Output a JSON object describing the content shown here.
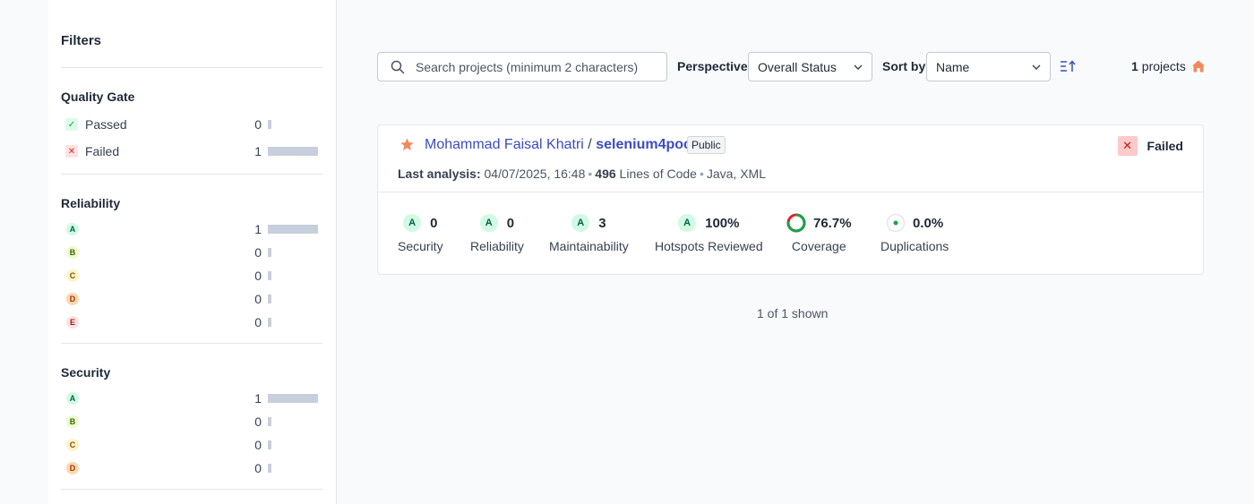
{
  "sidebar": {
    "title": "Filters",
    "quality_gate": {
      "title": "Quality Gate",
      "items": [
        {
          "label": "Passed",
          "count": "0",
          "fraction": 0
        },
        {
          "label": "Failed",
          "count": "1",
          "fraction": 1
        }
      ]
    },
    "reliability": {
      "title": "Reliability",
      "items": [
        {
          "rating": "A",
          "count": "1",
          "fraction": 1
        },
        {
          "rating": "B",
          "count": "0",
          "fraction": 0
        },
        {
          "rating": "C",
          "count": "0",
          "fraction": 0
        },
        {
          "rating": "D",
          "count": "0",
          "fraction": 0
        },
        {
          "rating": "E",
          "count": "0",
          "fraction": 0
        }
      ]
    },
    "security": {
      "title": "Security",
      "items": [
        {
          "rating": "A",
          "count": "1",
          "fraction": 1
        },
        {
          "rating": "B",
          "count": "0",
          "fraction": 0
        },
        {
          "rating": "C",
          "count": "0",
          "fraction": 0
        },
        {
          "rating": "D",
          "count": "0",
          "fraction": 0
        }
      ]
    }
  },
  "toolbar": {
    "search_placeholder": "Search projects (minimum 2 characters)",
    "perspective_label": "Perspective",
    "perspective_value": "Overall Status",
    "sort_label": "Sort by",
    "sort_value": "Name",
    "project_count": "1",
    "project_count_suffix": "projects"
  },
  "project": {
    "owner": "Mohammad Faisal Khatri",
    "separator": "/",
    "key": "selenium4poc",
    "visibility": "Public",
    "quality_gate": "Failed",
    "last_analysis_label": "Last analysis:",
    "last_analysis_value": "04/07/2025, 16:48",
    "loc_value": "496",
    "loc_label": "Lines of Code",
    "languages": "Java, XML",
    "measures": {
      "security": {
        "rating": "A",
        "value": "0",
        "label": "Security"
      },
      "reliability": {
        "rating": "A",
        "value": "0",
        "label": "Reliability"
      },
      "maintainability": {
        "rating": "A",
        "value": "3",
        "label": "Maintainability"
      },
      "hotspots": {
        "rating": "A",
        "value": "100%",
        "label": "Hotspots Reviewed"
      },
      "coverage": {
        "value": "76.7%",
        "label": "Coverage",
        "fraction": 0.767
      },
      "duplications": {
        "value": "0.0%",
        "label": "Duplications"
      }
    }
  },
  "footer": {
    "shown": "1 of 1 shown"
  },
  "colors": {
    "accent": "#3b4cc0",
    "failed": "#dc2626",
    "coverage_good": "#16a34a",
    "coverage_bad": "#dc2626",
    "star": "#f08a5d"
  }
}
